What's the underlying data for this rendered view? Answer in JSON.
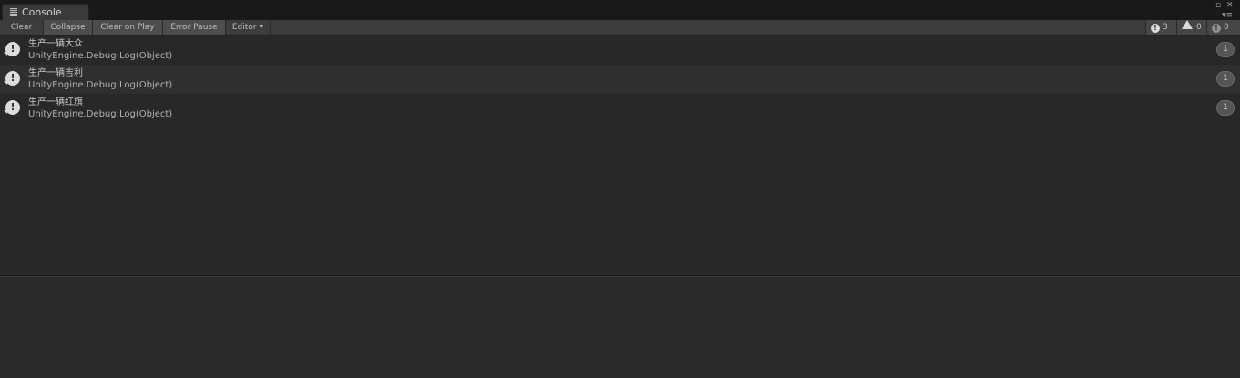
{
  "window": {
    "tab_label": "Console",
    "tab_icon": "console-lines-icon",
    "maximize_glyph": "▫",
    "close_glyph": "✕",
    "menu_glyph": "▾≡"
  },
  "toolbar": {
    "clear": "Clear",
    "collapse": "Collapse",
    "clear_on_play": "Clear on Play",
    "error_pause": "Error Pause",
    "editor": "Editor",
    "editor_caret": "▼",
    "counts": {
      "logs": "3",
      "warnings": "0",
      "errors": "0"
    }
  },
  "logs": [
    {
      "message": "生产一辆大众",
      "source": "UnityEngine.Debug:Log(Object)",
      "count": "1"
    },
    {
      "message": "生产一辆吉利",
      "source": "UnityEngine.Debug:Log(Object)",
      "count": "1"
    },
    {
      "message": "生产一辆红旗",
      "source": "UnityEngine.Debug:Log(Object)",
      "count": "1"
    }
  ],
  "log_icon_glyph": "!",
  "colors": {
    "background": "#282828",
    "toolbar": "#3c3c3c",
    "toggle_on": "#4d4d4d",
    "row_alt": "#2f2f2f",
    "text": "#c4c4c4"
  }
}
